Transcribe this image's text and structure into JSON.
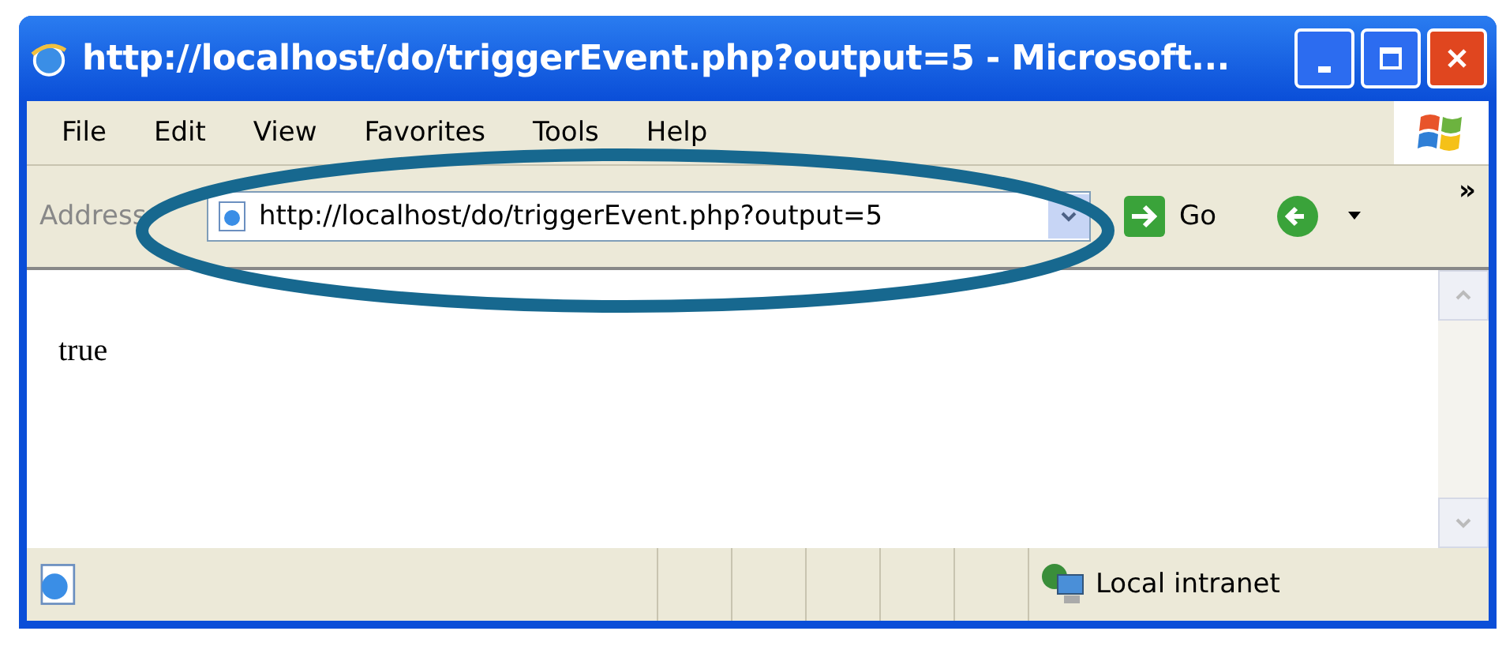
{
  "window": {
    "title": "http://localhost/do/triggerEvent.php?output=5 - Microsoft..."
  },
  "menu": [
    "File",
    "Edit",
    "View",
    "Favorites",
    "Tools",
    "Help"
  ],
  "address_bar": {
    "label": "Address",
    "value": "http://localhost/do/triggerEvent.php?output=5",
    "go": "Go"
  },
  "toolbar": {
    "overflow": "»"
  },
  "content": {
    "text": "true"
  },
  "status_bar": {
    "zone": "Local intranet"
  }
}
